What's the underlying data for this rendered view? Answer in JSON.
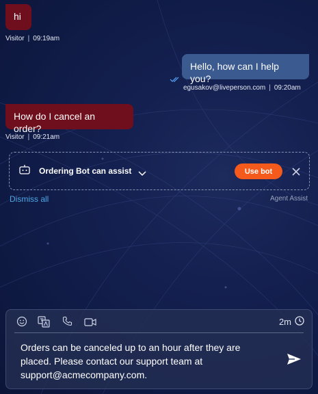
{
  "messages": [
    {
      "text": "hi",
      "sender": "Visitor",
      "time": "09:19am"
    },
    {
      "text": "Hello, how can I help you?",
      "sender": "egusakov@liveperson.com",
      "time": "09:20am"
    },
    {
      "text": "How do I cancel an order?",
      "sender": "Visitor",
      "time": "09:21am"
    }
  ],
  "assist": {
    "title": "Ordering Bot can assist",
    "use_bot_label": "Use bot",
    "dismiss_all_label": "Dismiss all",
    "source_label": "Agent Assist"
  },
  "composer": {
    "timer": "2m",
    "text": "Orders can be canceled up to an hour after they are placed. Please contact our support team at support@acmecompany.com."
  },
  "colors": {
    "visitor_bubble": "#6f0f1e",
    "agent_bubble": "#3b5a8f",
    "accent_orange": "#f35a1c",
    "link_blue": "#4fa7e6",
    "background": "#142050"
  },
  "icons": [
    "bot-icon",
    "chevron-down-icon",
    "close-icon",
    "emoji-icon",
    "translate-icon",
    "phone-icon",
    "video-icon",
    "clock-icon",
    "send-icon",
    "read-receipt-icon"
  ]
}
